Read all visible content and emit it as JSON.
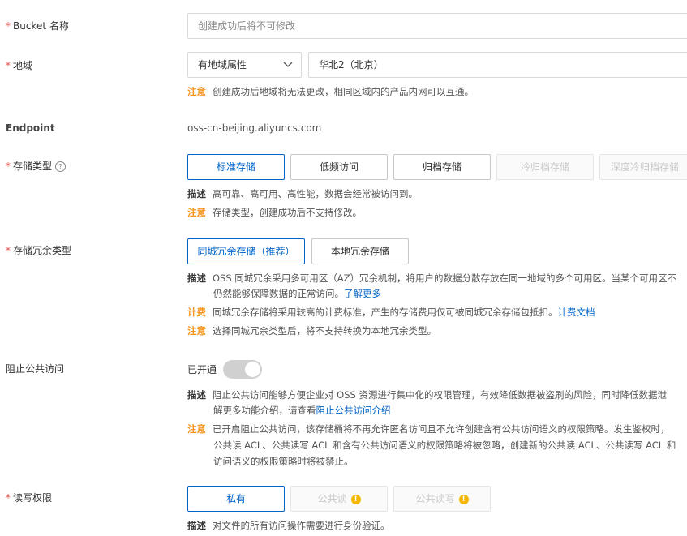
{
  "form": {
    "bucket_name": {
      "label": "Bucket 名称",
      "placeholder": "创建成功后将不可修改",
      "value": ""
    },
    "region": {
      "label": "地域",
      "attr_select": "有地域属性",
      "region_value": "华北2（北京）",
      "note_key": "注意",
      "note_text": "创建成功后地域将无法更改，相同区域内的产品内网可以互通。"
    },
    "endpoint": {
      "label": "Endpoint",
      "value": "oss-cn-beijing.aliyuncs.com"
    },
    "storage_class": {
      "label": "存储类型",
      "options": [
        "标准存储",
        "低频访问",
        "归档存储",
        "冷归档存储",
        "深度冷归档存储"
      ],
      "selected": "标准存储",
      "desc_key": "描述",
      "desc_text": "高可靠、高可用、高性能，数据会经常被访问到。",
      "note_key": "注意",
      "note_text": "存储类型，创建成功后不支持修改。"
    },
    "redundancy": {
      "label": "存储冗余类型",
      "options": [
        "同城冗余存储（推荐）",
        "本地冗余存储"
      ],
      "selected": "同城冗余存储（推荐）",
      "desc_key": "描述",
      "desc_line1": "OSS 同城冗余采用多可用区（AZ）冗余机制，将用户的数据分散存放在同一地域的多个可用区。当某个可用区不",
      "desc_line2": "仍然能够保障数据的正常访问。",
      "desc_link": "了解更多",
      "billing_key": "计费",
      "billing_text": "同城冗余存储将采用较高的计费标准，产生的存储费用仅可被同城冗余存储包抵扣。",
      "billing_link": "计费文档",
      "note_key": "注意",
      "note_text": "选择同城冗余类型后，将不支持转换为本地冗余类型。"
    },
    "block_public": {
      "label": "阻止公共访问",
      "toggle_label": "已开通",
      "toggle_on": true,
      "desc_key": "描述",
      "desc_line1": "阻止公共访问能够方便企业对 OSS 资源进行集中化的权限管理，有效降低数据被盗刷的风险，同时降低数据泄",
      "desc_line2": "解更多功能介绍，请查看",
      "desc_link": "阻止公共访问介绍",
      "note_key": "注意",
      "note_line1": "已开启阻止公共访问，该存储桶将不再允许匿名访问且不允许创建含有公共访问语义的权限策略。发生鉴权时，",
      "note_line2": "公共读 ACL、公共读写 ACL 和含有公共访问语义的权限策略将被忽略，创建新的公共读 ACL、公共读写 ACL 和",
      "note_line3": "访问语义的权限策略时将被禁止。"
    },
    "acl": {
      "label": "读写权限",
      "options": [
        "私有",
        "公共读",
        "公共读写"
      ],
      "selected": "私有",
      "desc_key": "描述",
      "desc_text": "对文件的所有访问操作需要进行身份验证。"
    }
  },
  "colors": {
    "accent": "#0064c8",
    "required": "#e1504a",
    "warning": "#f7941d"
  },
  "icons": [
    "question-circle-icon",
    "chevron-down-icon",
    "warning-icon"
  ]
}
